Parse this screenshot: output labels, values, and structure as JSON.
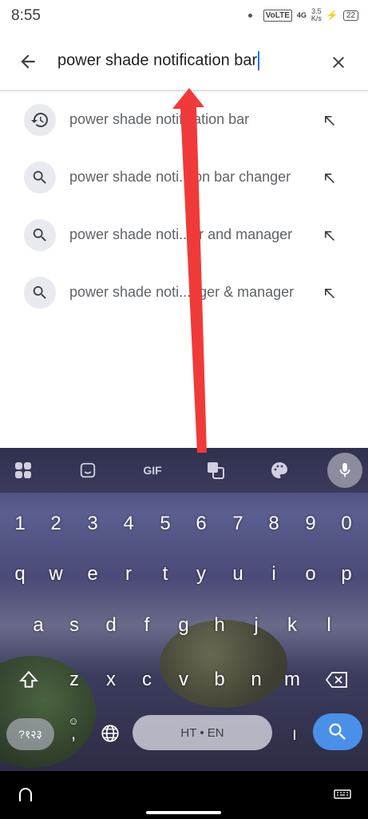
{
  "status_bar": {
    "time": "8:55",
    "network": "VoLTE",
    "signal": "4G",
    "speed_value": "3.5",
    "speed_unit": "K/s",
    "battery": "22"
  },
  "search": {
    "query": "power shade notification bar"
  },
  "suggestions": [
    {
      "text": "power shade notification bar",
      "icon": "history-icon"
    },
    {
      "text": "power shade noti..tion bar changer",
      "icon": "search-icon"
    },
    {
      "text": "power shade noti...er and manager",
      "icon": "search-icon"
    },
    {
      "text": "power shade noti...nger & manager",
      "icon": "search-icon"
    }
  ],
  "keyboard": {
    "toolbar": {
      "gif_label": "GIF"
    },
    "rows": [
      [
        "1",
        "2",
        "3",
        "4",
        "5",
        "6",
        "7",
        "8",
        "9",
        "0"
      ],
      [
        "q",
        "w",
        "e",
        "r",
        "t",
        "y",
        "u",
        "i",
        "o",
        "p"
      ],
      [
        "a",
        "s",
        "d",
        "f",
        "g",
        "h",
        "j",
        "k",
        "l"
      ],
      [
        "z",
        "x",
        "c",
        "v",
        "b",
        "n",
        "m"
      ]
    ],
    "symbols_label": "?१२३",
    "comma_label": ",",
    "emoji_hint": "☺",
    "space_label": "HT • EN",
    "period_label": "।"
  },
  "colors": {
    "accent": "#1a73e8",
    "annotation_arrow": "#f03a3a",
    "search_key": "#4a8fe8"
  }
}
